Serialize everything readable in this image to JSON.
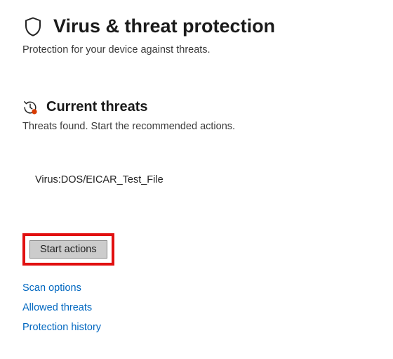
{
  "page": {
    "title": "Virus & threat protection",
    "subtitle": "Protection for your device against threats."
  },
  "section": {
    "title": "Current threats",
    "subtitle": "Threats found. Start the recommended actions."
  },
  "threats": {
    "items": [
      {
        "name": "Virus:DOS/EICAR_Test_File"
      }
    ]
  },
  "actions": {
    "start_label": "Start actions"
  },
  "links": {
    "scan_options": "Scan options",
    "allowed_threats": "Allowed threats",
    "protection_history": "Protection history"
  }
}
